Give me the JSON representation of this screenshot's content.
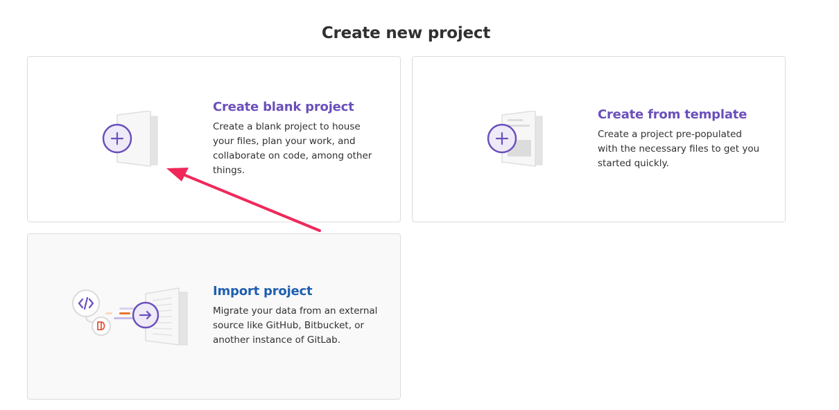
{
  "page": {
    "title": "Create new project"
  },
  "cards": {
    "blank": {
      "title": "Create blank project",
      "description": "Create a blank project to house your files, plan your work, and collaborate on code, among other things."
    },
    "template": {
      "title": "Create from template",
      "description": "Create a project pre-populated with the necessary files to get you started quickly."
    },
    "import": {
      "title": "Import project",
      "description": "Migrate your data from an external source like GitHub, Bitbucket, or another instance of GitLab."
    }
  },
  "colors": {
    "accent_purple": "#6b4fbb",
    "import_title_blue": "#1f5fb0",
    "annotation_arrow": "#f0285a",
    "gitlab_orange": "#e24329"
  }
}
